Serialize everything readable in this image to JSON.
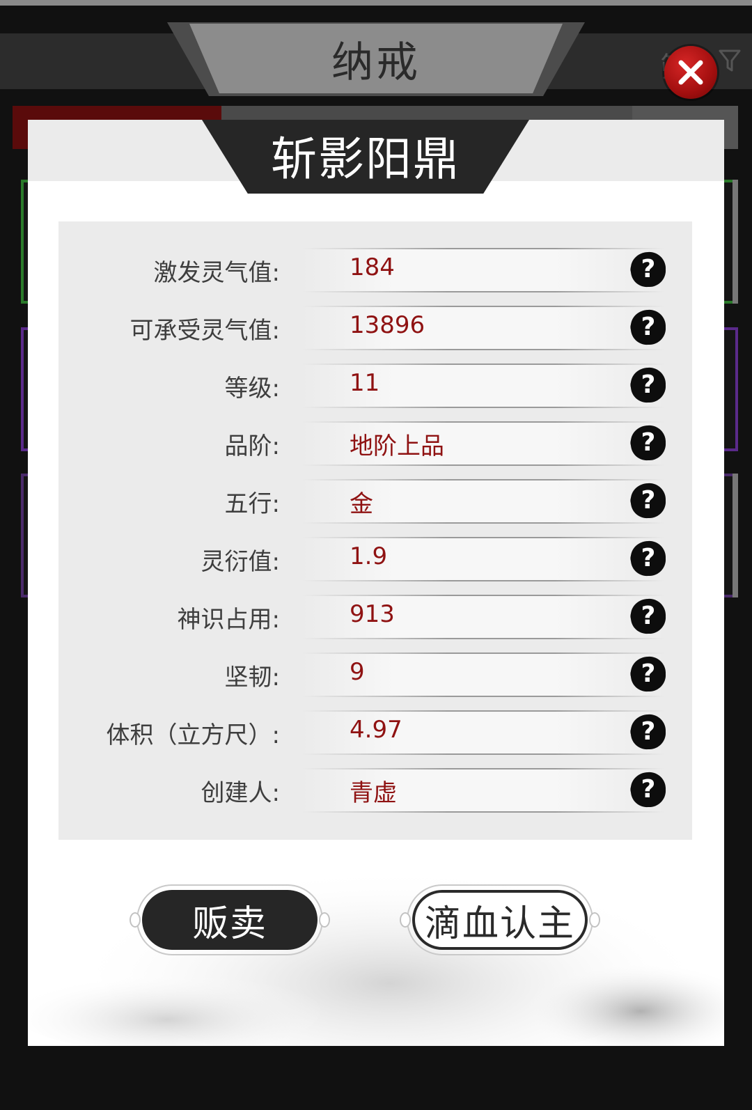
{
  "background_screen": {
    "title": "纳戒",
    "filter_label": "筛",
    "filter_icon": "filter-icon"
  },
  "close_icon": "close-icon",
  "modal": {
    "title": "斩影阳鼎",
    "stats": [
      {
        "label": "激发灵气值:",
        "value": "184"
      },
      {
        "label": "可承受灵气值:",
        "value": "13896"
      },
      {
        "label": "等级:",
        "value": "11"
      },
      {
        "label": "品阶:",
        "value": "地阶上品"
      },
      {
        "label": "五行:",
        "value": "金"
      },
      {
        "label": "灵衍值:",
        "value": "1.9"
      },
      {
        "label": "神识占用:",
        "value": "913"
      },
      {
        "label": "坚韧:",
        "value": "9"
      },
      {
        "label": "体积（立方尺）:",
        "value": "4.97"
      },
      {
        "label": "创建人:",
        "value": "青虚"
      }
    ],
    "help_icon": "question-mark-icon",
    "buttons": {
      "sell": "贩卖",
      "bind": "滴血认主"
    }
  },
  "colors": {
    "value_text": "#8f1212",
    "close_button": "#b31515",
    "title_tab": "#262626"
  }
}
